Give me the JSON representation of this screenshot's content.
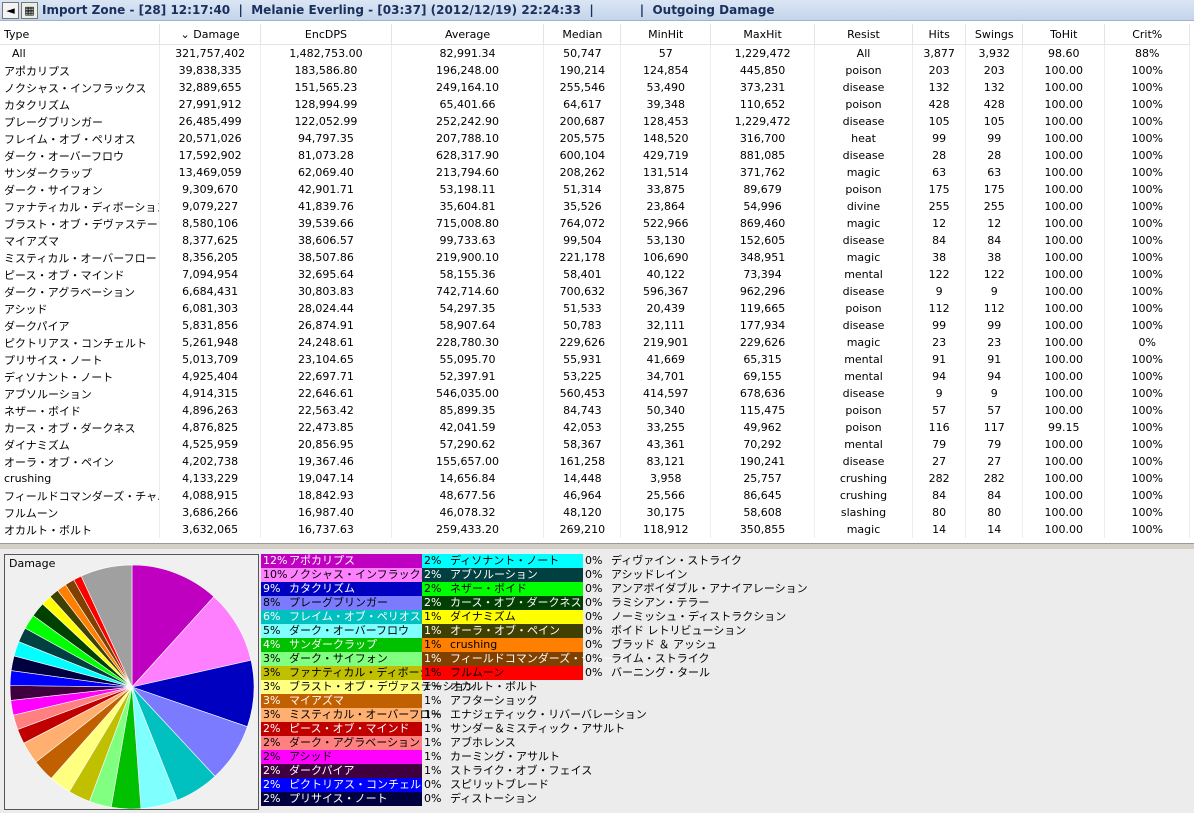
{
  "titlebar": {
    "text": "Import Zone - [28] 12:17:40  |  Melanie Everling - [03:37] (2012/12/19) 22:24:33  |           |  Outgoing Damage"
  },
  "columns": [
    "Type",
    "Damage",
    "EncDPS",
    "Average",
    "Median",
    "MinHit",
    "MaxHit",
    "Resist",
    "Hits",
    "Swings",
    "ToHit",
    "Crit%"
  ],
  "sort_indicator": "⌄",
  "rows": [
    [
      "All",
      "321,757,402",
      "1,482,753.00",
      "82,991.34",
      "50,747",
      "57",
      "1,229,472",
      "All",
      "3,877",
      "3,932",
      "98.60",
      "88%"
    ],
    [
      "アポカリプス",
      "39,838,335",
      "183,586.80",
      "196,248.00",
      "190,214",
      "124,854",
      "445,850",
      "poison",
      "203",
      "203",
      "100.00",
      "100%"
    ],
    [
      "ノクシャス・インフラックス",
      "32,889,655",
      "151,565.23",
      "249,164.10",
      "255,546",
      "53,490",
      "373,231",
      "disease",
      "132",
      "132",
      "100.00",
      "100%"
    ],
    [
      "カタクリズム",
      "27,991,912",
      "128,994.99",
      "65,401.66",
      "64,617",
      "39,348",
      "110,652",
      "poison",
      "428",
      "428",
      "100.00",
      "100%"
    ],
    [
      "プレーグブリンガー",
      "26,485,499",
      "122,052.99",
      "252,242.90",
      "200,687",
      "128,453",
      "1,229,472",
      "disease",
      "105",
      "105",
      "100.00",
      "100%"
    ],
    [
      "フレイム・オブ・ペリオス",
      "20,571,026",
      "94,797.35",
      "207,788.10",
      "205,575",
      "148,520",
      "316,700",
      "heat",
      "99",
      "99",
      "100.00",
      "100%"
    ],
    [
      "ダーク・オーバーフロウ",
      "17,592,902",
      "81,073.28",
      "628,317.90",
      "600,104",
      "429,719",
      "881,085",
      "disease",
      "28",
      "28",
      "100.00",
      "100%"
    ],
    [
      "サンダークラップ",
      "13,469,059",
      "62,069.40",
      "213,794.60",
      "208,262",
      "131,514",
      "371,762",
      "magic",
      "63",
      "63",
      "100.00",
      "100%"
    ],
    [
      "ダーク・サイフォン",
      "9,309,670",
      "42,901.71",
      "53,198.11",
      "51,314",
      "33,875",
      "89,679",
      "poison",
      "175",
      "175",
      "100.00",
      "100%"
    ],
    [
      "ファナティカル・ディボーション",
      "9,079,227",
      "41,839.76",
      "35,604.81",
      "35,526",
      "23,864",
      "54,996",
      "divine",
      "255",
      "255",
      "100.00",
      "100%"
    ],
    [
      "ブラスト・オブ・デヴァステーシ...",
      "8,580,106",
      "39,539.66",
      "715,008.80",
      "764,072",
      "522,966",
      "869,460",
      "magic",
      "12",
      "12",
      "100.00",
      "100%"
    ],
    [
      "マイアズマ",
      "8,377,625",
      "38,606.57",
      "99,733.63",
      "99,504",
      "53,130",
      "152,605",
      "disease",
      "84",
      "84",
      "100.00",
      "100%"
    ],
    [
      "ミスティカル・オーバーフロー",
      "8,356,205",
      "38,507.86",
      "219,900.10",
      "221,178",
      "106,690",
      "348,951",
      "magic",
      "38",
      "38",
      "100.00",
      "100%"
    ],
    [
      "ピース・オブ・マインド",
      "7,094,954",
      "32,695.64",
      "58,155.36",
      "58,401",
      "40,122",
      "73,394",
      "mental",
      "122",
      "122",
      "100.00",
      "100%"
    ],
    [
      "ダーク・アグラベーション",
      "6,684,431",
      "30,803.83",
      "742,714.60",
      "700,632",
      "596,367",
      "962,296",
      "disease",
      "9",
      "9",
      "100.00",
      "100%"
    ],
    [
      "アシッド",
      "6,081,303",
      "28,024.44",
      "54,297.35",
      "51,533",
      "20,439",
      "119,665",
      "poison",
      "112",
      "112",
      "100.00",
      "100%"
    ],
    [
      "ダークパイア",
      "5,831,856",
      "26,874.91",
      "58,907.64",
      "50,783",
      "32,111",
      "177,934",
      "disease",
      "99",
      "99",
      "100.00",
      "100%"
    ],
    [
      "ピクトリアス・コンチェルト",
      "5,261,948",
      "24,248.61",
      "228,780.30",
      "229,626",
      "219,901",
      "229,626",
      "magic",
      "23",
      "23",
      "100.00",
      "0%"
    ],
    [
      "プリサイス・ノート",
      "5,013,709",
      "23,104.65",
      "55,095.70",
      "55,931",
      "41,669",
      "65,315",
      "mental",
      "91",
      "91",
      "100.00",
      "100%"
    ],
    [
      "ディソナント・ノート",
      "4,925,404",
      "22,697.71",
      "52,397.91",
      "53,225",
      "34,701",
      "69,155",
      "mental",
      "94",
      "94",
      "100.00",
      "100%"
    ],
    [
      "アブソルーション",
      "4,914,315",
      "22,646.61",
      "546,035.00",
      "560,453",
      "414,597",
      "678,636",
      "disease",
      "9",
      "9",
      "100.00",
      "100%"
    ],
    [
      "ネザー・ボイド",
      "4,896,263",
      "22,563.42",
      "85,899.35",
      "84,743",
      "50,340",
      "115,475",
      "poison",
      "57",
      "57",
      "100.00",
      "100%"
    ],
    [
      "カース・オブ・ダークネス",
      "4,876,825",
      "22,473.85",
      "42,041.59",
      "42,053",
      "33,255",
      "49,962",
      "poison",
      "116",
      "117",
      "99.15",
      "100%"
    ],
    [
      "ダイナミズム",
      "4,525,959",
      "20,856.95",
      "57,290.62",
      "58,367",
      "43,361",
      "70,292",
      "mental",
      "79",
      "79",
      "100.00",
      "100%"
    ],
    [
      "オーラ・オブ・ペイン",
      "4,202,738",
      "19,367.46",
      "155,657.00",
      "161,258",
      "83,121",
      "190,241",
      "disease",
      "27",
      "27",
      "100.00",
      "100%"
    ],
    [
      "crushing",
      "4,133,229",
      "19,047.14",
      "14,656.84",
      "14,448",
      "3,958",
      "25,757",
      "crushing",
      "282",
      "282",
      "100.00",
      "100%"
    ],
    [
      "フィールドコマンダーズ・チャ...",
      "4,088,915",
      "18,842.93",
      "48,677.56",
      "46,964",
      "25,566",
      "86,645",
      "crushing",
      "84",
      "84",
      "100.00",
      "100%"
    ],
    [
      "フルムーン",
      "3,686,266",
      "16,987.40",
      "46,078.32",
      "48,120",
      "30,175",
      "58,608",
      "slashing",
      "80",
      "80",
      "100.00",
      "100%"
    ],
    [
      "オカルト・ボルト",
      "3,632,065",
      "16,737.63",
      "259,433.20",
      "269,210",
      "118,912",
      "350,855",
      "magic",
      "14",
      "14",
      "100.00",
      "100%"
    ]
  ],
  "graph": {
    "label": "Damage",
    "legend_columns": [
      [
        {
          "pct": "12%",
          "name": "アポカリプス",
          "color": "#c000c0"
        },
        {
          "pct": "10%",
          "name": "ノクシャス・インフラックス",
          "color": "#ff80ff"
        },
        {
          "pct": "9%",
          "name": "カタクリズム",
          "color": "#0000c0"
        },
        {
          "pct": "8%",
          "name": "プレーグブリンガー",
          "color": "#7b7bff"
        },
        {
          "pct": "6%",
          "name": "フレイム・オブ・ペリオス",
          "color": "#00c0c0"
        },
        {
          "pct": "5%",
          "name": "ダーク・オーバーフロウ",
          "color": "#80ffff"
        },
        {
          "pct": "4%",
          "name": "サンダークラップ",
          "color": "#00c000"
        },
        {
          "pct": "3%",
          "name": "ダーク・サイフォン",
          "color": "#80ff80"
        },
        {
          "pct": "3%",
          "name": "ファナティカル・ディボーション",
          "color": "#c0c000"
        },
        {
          "pct": "3%",
          "name": "ブラスト・オブ・デヴァステーション",
          "color": "#ffff80"
        },
        {
          "pct": "3%",
          "name": "マイアズマ",
          "color": "#c06000"
        },
        {
          "pct": "3%",
          "name": "ミスティカル・オーバーフロー",
          "color": "#ffb070"
        },
        {
          "pct": "2%",
          "name": "ピース・オブ・マインド",
          "color": "#c00000"
        },
        {
          "pct": "2%",
          "name": "ダーク・アグラベーション",
          "color": "#ff8080"
        },
        {
          "pct": "2%",
          "name": "アシッド",
          "color": "#ff00ff"
        },
        {
          "pct": "2%",
          "name": "ダークパイア",
          "color": "#400040"
        },
        {
          "pct": "2%",
          "name": "ピクトリアス・コンチェルト",
          "color": "#0000ff"
        },
        {
          "pct": "2%",
          "name": "プリサイス・ノート",
          "color": "#000040"
        }
      ],
      [
        {
          "pct": "2%",
          "name": "ディソナント・ノート",
          "color": "#00ffff"
        },
        {
          "pct": "2%",
          "name": "アブソルーション",
          "color": "#004040"
        },
        {
          "pct": "2%",
          "name": "ネザー・ボイド",
          "color": "#00ff00"
        },
        {
          "pct": "2%",
          "name": "カース・オブ・ダークネス",
          "color": "#004000"
        },
        {
          "pct": "1%",
          "name": "ダイナミズム",
          "color": "#ffff00"
        },
        {
          "pct": "1%",
          "name": "オーラ・オブ・ペイン",
          "color": "#404000"
        },
        {
          "pct": "1%",
          "name": "crushing",
          "color": "#ff8000"
        },
        {
          "pct": "1%",
          "name": "フィールドコマンダーズ・チャージ",
          "color": "#804000"
        },
        {
          "pct": "1%",
          "name": "フルムーン",
          "color": "#ff0000"
        },
        {
          "pct": "1%",
          "name": "オカルト・ボルト",
          "color": "#ececec"
        },
        {
          "pct": "1%",
          "name": "アフターショック",
          "color": "#ececec"
        },
        {
          "pct": "1%",
          "name": "エナジェティック・リバーバレーション",
          "color": "#ececec"
        },
        {
          "pct": "1%",
          "name": "サンダー＆ミスティック・アサルト",
          "color": "#ececec"
        },
        {
          "pct": "1%",
          "name": "アブホレンス",
          "color": "#ececec"
        },
        {
          "pct": "1%",
          "name": "カーミング・アサルト",
          "color": "#ececec"
        },
        {
          "pct": "1%",
          "name": "ストライク・オブ・フェイス",
          "color": "#ececec"
        },
        {
          "pct": "0%",
          "name": "スピリットブレード",
          "color": "#ececec"
        },
        {
          "pct": "0%",
          "name": "ディストーション",
          "color": "#ececec"
        }
      ],
      [
        {
          "pct": "0%",
          "name": "ディヴァイン・ストライク",
          "color": "#ececec"
        },
        {
          "pct": "0%",
          "name": "アシッドレイン",
          "color": "#ececec"
        },
        {
          "pct": "0%",
          "name": "アンアボイダブル・アナイアレーション",
          "color": "#ececec"
        },
        {
          "pct": "0%",
          "name": "ラミシアン・テラー",
          "color": "#ececec"
        },
        {
          "pct": "0%",
          "name": "ノーミッシュ・ディストラクション",
          "color": "#ececec"
        },
        {
          "pct": "0%",
          "name": "ボイド レトリビューション",
          "color": "#ececec"
        },
        {
          "pct": "0%",
          "name": "ブラッド ＆ アッシュ",
          "color": "#ececec"
        },
        {
          "pct": "0%",
          "name": "ライム・ストライク",
          "color": "#ececec"
        },
        {
          "pct": "0%",
          "name": "バーニング・タール",
          "color": "#ececec"
        }
      ]
    ],
    "pie_slices": [
      {
        "value": 12,
        "color": "#c000c0"
      },
      {
        "value": 10,
        "color": "#ff80ff"
      },
      {
        "value": 9,
        "color": "#0000c0"
      },
      {
        "value": 8,
        "color": "#7b7bff"
      },
      {
        "value": 6,
        "color": "#00c0c0"
      },
      {
        "value": 5,
        "color": "#80ffff"
      },
      {
        "value": 4,
        "color": "#00c000"
      },
      {
        "value": 3,
        "color": "#80ff80"
      },
      {
        "value": 3,
        "color": "#c0c000"
      },
      {
        "value": 3,
        "color": "#ffff80"
      },
      {
        "value": 3,
        "color": "#c06000"
      },
      {
        "value": 3,
        "color": "#ffb070"
      },
      {
        "value": 2,
        "color": "#c00000"
      },
      {
        "value": 2,
        "color": "#ff8080"
      },
      {
        "value": 2,
        "color": "#ff00ff"
      },
      {
        "value": 2,
        "color": "#400040"
      },
      {
        "value": 2,
        "color": "#0000ff"
      },
      {
        "value": 2,
        "color": "#000040"
      },
      {
        "value": 2,
        "color": "#00ffff"
      },
      {
        "value": 2,
        "color": "#004040"
      },
      {
        "value": 2,
        "color": "#00ff00"
      },
      {
        "value": 2,
        "color": "#004000"
      },
      {
        "value": 1.4,
        "color": "#ffff00"
      },
      {
        "value": 1.3,
        "color": "#404000"
      },
      {
        "value": 1.3,
        "color": "#ff8000"
      },
      {
        "value": 1.3,
        "color": "#804000"
      },
      {
        "value": 1.1,
        "color": "#ff0000"
      },
      {
        "value": 7,
        "color": "#a0a0a0"
      }
    ]
  }
}
